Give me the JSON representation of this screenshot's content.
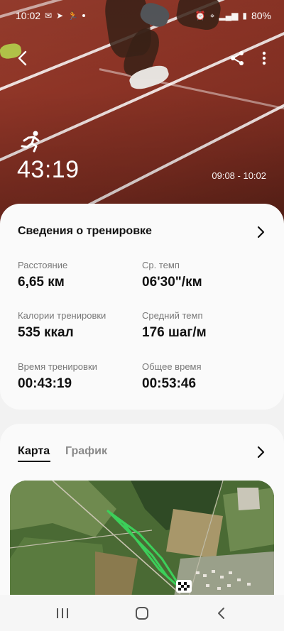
{
  "status_bar": {
    "time": "10:02",
    "battery": "80%"
  },
  "hero": {
    "duration": "43:19",
    "time_range": "09:08 - 10:02"
  },
  "details": {
    "title": "Сведения о тренировке",
    "stats": [
      {
        "label": "Расстояние",
        "value": "6,65 км"
      },
      {
        "label": "Ср. темп",
        "value": "06'30\"/км"
      },
      {
        "label": "Калории тренировки",
        "value": "535 ккал"
      },
      {
        "label": "Средний темп",
        "value": "176 шаг/м"
      },
      {
        "label": "Время тренировки",
        "value": "00:43:19"
      },
      {
        "label": "Общее время",
        "value": "00:53:46"
      }
    ]
  },
  "map_section": {
    "tabs": [
      {
        "label": "Карта",
        "active": true
      },
      {
        "label": "График",
        "active": false
      }
    ],
    "route_color": "#3ccf5a"
  },
  "colors": {
    "track": "#8d3426",
    "card_bg": "#fafafa",
    "page_bg": "#f2f2f2"
  },
  "icons": {
    "back": "chevron-left-icon",
    "share": "share-icon",
    "more": "more-vert-icon",
    "run": "running-icon",
    "chevron": "chevron-right-icon",
    "nav_recent": "recent-apps-icon",
    "nav_home": "home-icon",
    "nav_back": "nav-back-icon"
  }
}
